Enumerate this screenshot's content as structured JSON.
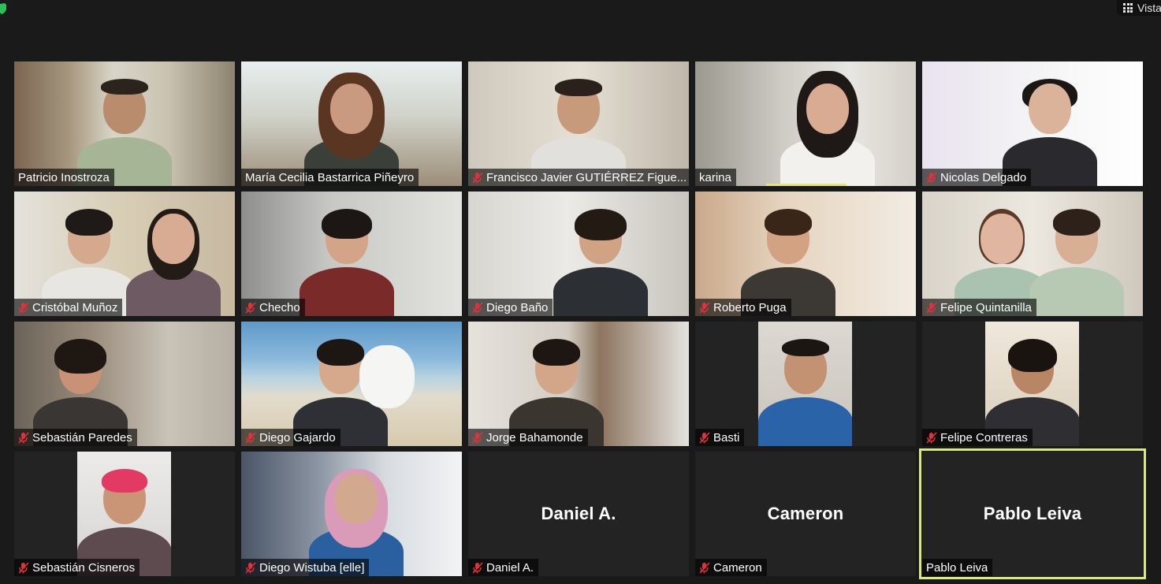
{
  "app": {
    "view_label": "Vista",
    "colors": {
      "background": "#1a1a1a",
      "active_speaker": "#d7ec7a",
      "mute_red": "#e0323c"
    }
  },
  "participants": [
    {
      "name": "Patricio Inostroza",
      "muted": false,
      "video": true
    },
    {
      "name": "María Cecilia Bastarrica Piñeyro",
      "muted": false,
      "video": true
    },
    {
      "name": "Francisco Javier GUTIÉRREZ Figue...",
      "muted": true,
      "video": true
    },
    {
      "name": "karina",
      "muted": false,
      "video": true,
      "speaking": true
    },
    {
      "name": "Nicolas Delgado",
      "muted": true,
      "video": true
    },
    {
      "name": "Cristóbal Muñoz",
      "muted": true,
      "video": true
    },
    {
      "name": "Checho",
      "muted": true,
      "video": true
    },
    {
      "name": "Diego Baño",
      "muted": true,
      "video": true
    },
    {
      "name": "Roberto Puga",
      "muted": true,
      "video": true
    },
    {
      "name": "Felipe Quintanilla",
      "muted": true,
      "video": true
    },
    {
      "name": "Sebastián Paredes",
      "muted": true,
      "video": true
    },
    {
      "name": "Diego Gajardo",
      "muted": true,
      "video": true
    },
    {
      "name": "Jorge Bahamonde",
      "muted": true,
      "video": true
    },
    {
      "name": "Basti",
      "muted": true,
      "video": true
    },
    {
      "name": "Felipe Contreras",
      "muted": true,
      "video": true
    },
    {
      "name": "Sebastián Cisneros",
      "muted": true,
      "video": true
    },
    {
      "name": "Diego Wistuba [elle]",
      "muted": true,
      "video": true
    },
    {
      "name": "Daniel A.",
      "muted": true,
      "video": false,
      "display_name": "Daniel A."
    },
    {
      "name": "Cameron",
      "muted": true,
      "video": false,
      "display_name": "Cameron"
    },
    {
      "name": "Pablo Leiva",
      "muted": false,
      "video": false,
      "display_name": "Pablo Leiva",
      "active_speaker": true
    }
  ]
}
